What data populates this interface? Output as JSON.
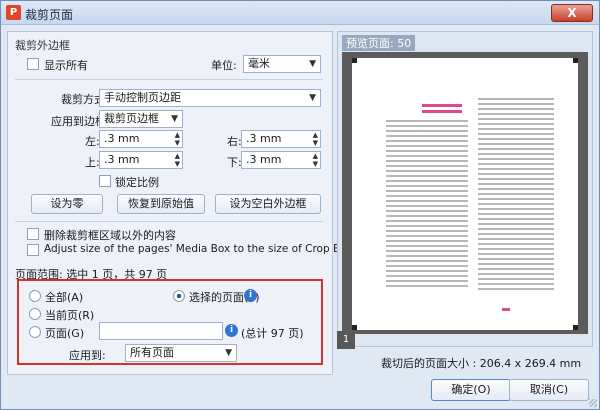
{
  "window": {
    "title": "裁剪页面",
    "close": "X"
  },
  "crop_margins": {
    "section_title": "裁剪外边框",
    "show_all": "显示所有",
    "unit_label": "单位:",
    "unit_value": "毫米",
    "crop_mode_label": "裁剪方式",
    "crop_mode_value": "手动控制页边距",
    "apply_to_label": "应用到边框",
    "apply_to_value": "裁剪页边框",
    "left_label": "左:",
    "left_value": ".3 mm",
    "right_label": "右:",
    "right_value": ".3 mm",
    "top_label": "上:",
    "top_value": ".3 mm",
    "bottom_label": "下:",
    "bottom_value": ".3 mm",
    "lock_ratio": "锁定比例",
    "btn_zero": "设为零",
    "btn_restore": "恢复到原始值",
    "btn_white": "设为空白外边框",
    "delete_outside": "删除裁剪框区域以外的内容",
    "adjust_media_box": "Adjust size of the pages' Media Box to the size of Crop Box"
  },
  "page_range": {
    "summary": "页面范围: 选中 1 页，共 97 页",
    "all": "全部(A)",
    "current": "当前页(R)",
    "pages": "页面(G)",
    "selected_pages": "选择的页面(S)",
    "total": "(总计 97 页)",
    "apply_to_label": "应用到:",
    "apply_to_value": "所有页面",
    "info_icon": "i"
  },
  "preview": {
    "title": "预览页面: 50",
    "page_number": "1",
    "crop_size": "裁切后的页面大小 : 206.4 x 269.4 mm"
  },
  "footer": {
    "ok": "确定(O)",
    "cancel": "取消(C)"
  },
  "colors": {
    "highlight": "#d6312b",
    "accent": "#2e76d1"
  }
}
